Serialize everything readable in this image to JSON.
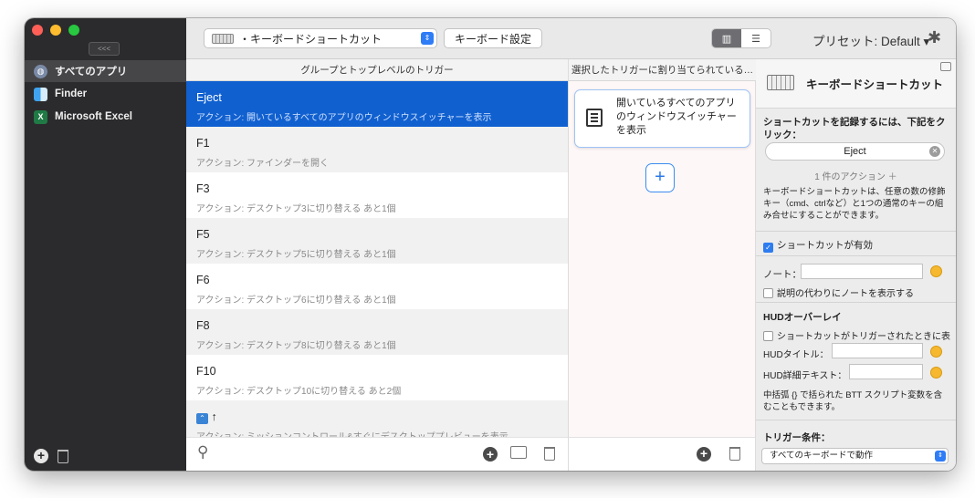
{
  "sidebar": {
    "collapse_label": "<<<",
    "items": [
      {
        "label": "すべてのアプリ",
        "icon": "globe-icon"
      },
      {
        "label": "Finder",
        "icon": "finder-icon"
      },
      {
        "label": "Microsoft Excel",
        "icon": "excel-icon",
        "icon_text": "X"
      }
    ]
  },
  "toolbar": {
    "trigger_type": "・キーボードショートカット",
    "kb_settings": "キーボード設定",
    "preset": "プリセット: Default ▾"
  },
  "columns": {
    "triggers_header": "グループとトップレベルのトリガー",
    "assigned_header": "選択したトリガーに割り当てられている…"
  },
  "triggers": [
    {
      "title": "Eject",
      "action": "アクション: 開いているすべてのアプリのウィンドウスイッチャーを表示"
    },
    {
      "title": "F1",
      "action": "アクション: ファインダーを開く"
    },
    {
      "title": "F3",
      "action": "アクション: デスクトップ3に切り替える あと1個"
    },
    {
      "title": "F5",
      "action": "アクション: デスクトップ5に切り替える あと1個"
    },
    {
      "title": "F6",
      "action": "アクション: デスクトップ6に切り替える あと1個"
    },
    {
      "title": "F8",
      "action": "アクション: デスクトップ8に切り替える あと1個"
    },
    {
      "title": "F10",
      "action": "アクション: デスクトップ10に切り替える あと2個"
    },
    {
      "title": "↑",
      "action": "アクション: ミッションコントロール&すぐにデスクトッププレビューを表示"
    }
  ],
  "assigned": {
    "action_text": "開いているすべてのアプリのウィンドウスイッチャーを表示",
    "add_label": "+"
  },
  "panel": {
    "title": "キーボードショートカット",
    "record_prompt": "ショートカットを記録するには、下記をクリック：",
    "shortcut_value": "Eject",
    "action_count": "1 件のアクション ＋",
    "description": "キーボードショートカットは、任意の数の修飾キー（cmd、ctrlなど）と1つの通常のキーの組み合せにすることができます。",
    "enabled_label": "ショートカットが有効",
    "note_label": "ノート：",
    "show_note_label": "説明の代わりにノートを表示する",
    "hud_heading": "HUDオーバーレイ",
    "hud_show_label": "ショートカットがトリガーされたときに表",
    "hud_title_label": "HUDタイトル：",
    "hud_detail_label": "HUD詳細テキスト：",
    "bttvar_note": "中括弧 {} で括られた BTT スクリプト変数を含むこともできます。",
    "conditions_heading": "トリガー条件：",
    "conditions_value": "すべてのキーボードで動作"
  },
  "colors": {
    "selection": "#1060d0",
    "accent": "#2e7cf6",
    "sidebar_bg": "#2b2b2d"
  }
}
